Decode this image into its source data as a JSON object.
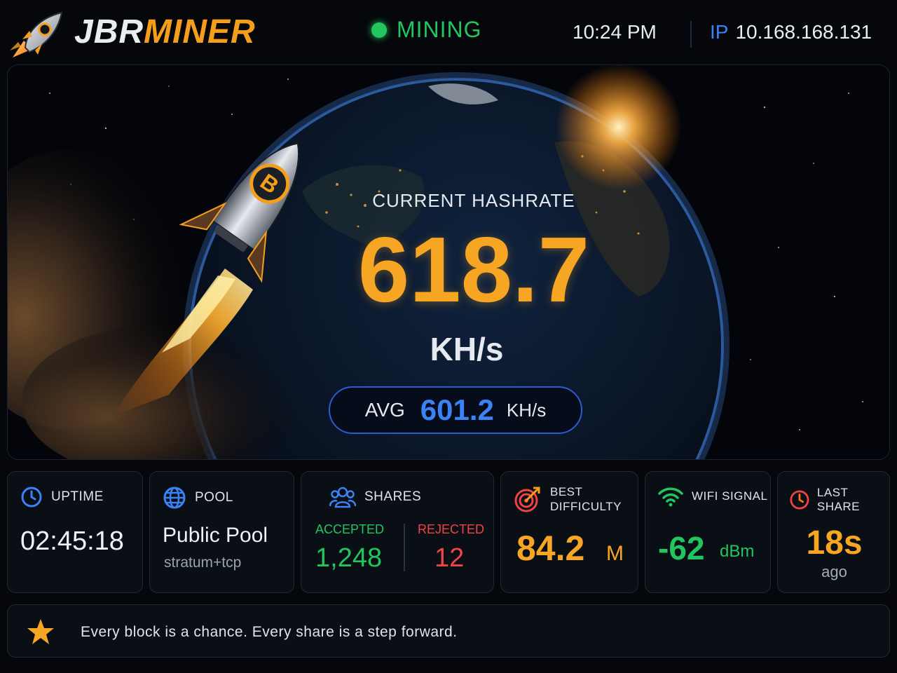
{
  "header": {
    "brand_part1": "JBR",
    "brand_part2": "MINER",
    "status": "MINING",
    "time": "10:24  PM",
    "ip_label": "IP",
    "ip_value": "10.168.168.131"
  },
  "hero": {
    "title": "CURRENT HASHRATE",
    "hashrate": "618.7",
    "unit": "KH/s",
    "avg_label": "AVG",
    "avg_value": "601.2",
    "avg_unit": "KH/s"
  },
  "cards": {
    "uptime": {
      "title": "UPTIME",
      "value": "02:45:18",
      "icon": "clock-icon"
    },
    "pool": {
      "title": "POOL",
      "value": "Public Pool",
      "sub": "stratum+tcp",
      "icon": "globe-icon"
    },
    "shares": {
      "title": "SHARES",
      "accepted_label": "ACCEPTED",
      "accepted_value": "1,248",
      "rejected_label": "REJECTED",
      "rejected_value": "12",
      "icon": "users-icon"
    },
    "difficulty": {
      "title_line1": "BEST",
      "title_line2": "DIFFICULTY",
      "value": "84.2",
      "unit": "M",
      "icon": "target-icon"
    },
    "wifi": {
      "title": "WIFI SIGNAL",
      "value": "-62",
      "unit": "dBm",
      "icon": "wifi-icon"
    },
    "last_share": {
      "title": "LAST SHARE",
      "value": "18s",
      "sub": "ago",
      "icon": "clock-icon"
    }
  },
  "footer": {
    "quote": "Every block is a chance. Every share is a step forward.",
    "icon": "star-icon"
  },
  "colors": {
    "accent_orange": "#f7a623",
    "status_green": "#22c55e",
    "accent_blue": "#3b82f6",
    "reject_red": "#ef4444"
  }
}
